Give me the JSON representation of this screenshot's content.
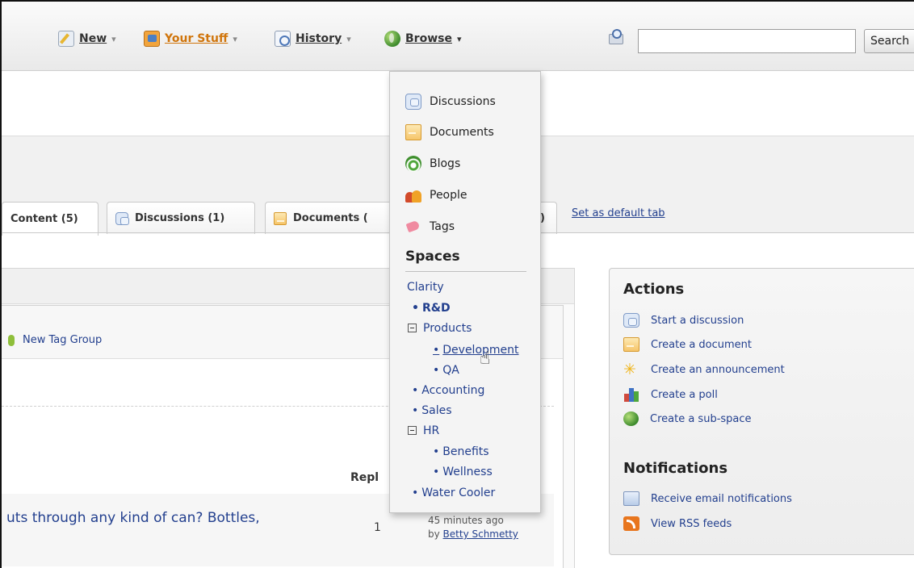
{
  "nav": {
    "items": [
      {
        "label": "New",
        "icon": "pencil-page-icon"
      },
      {
        "label": "Your Stuff",
        "icon": "user-folder-icon"
      },
      {
        "label": "History",
        "icon": "history-clock-icon"
      },
      {
        "label": "Browse",
        "icon": "globe-icon"
      }
    ],
    "search": {
      "value": "",
      "button_label": "Search"
    }
  },
  "tabs": {
    "items": [
      "Content (5)",
      "Discussions (1)",
      "Documents ("
    ],
    "partial_tail": ")",
    "set_default": "Set as default tab"
  },
  "content": {
    "new_tag_group": "New Tag Group",
    "replies_header": "Repl",
    "row": {
      "title": "uts through any kind of can? Bottles,",
      "replies": "1",
      "time": "45 minutes ago",
      "by_prefix": "by ",
      "author": "Betty Schmetty"
    }
  },
  "dropdown": {
    "items": [
      {
        "label": "Discussions",
        "icon": "discussions-icon"
      },
      {
        "label": "Documents",
        "icon": "document-icon"
      },
      {
        "label": "Blogs",
        "icon": "blog-icon"
      },
      {
        "label": "People",
        "icon": "people-icon"
      },
      {
        "label": "Tags",
        "icon": "tag-icon"
      }
    ],
    "spaces_heading": "Spaces",
    "spaces": {
      "clarity": "Clarity",
      "rd": "R&D",
      "products": "Products",
      "development": "Development",
      "qa": "QA",
      "accounting": "Accounting",
      "sales": "Sales",
      "hr": "HR",
      "benefits": "Benefits",
      "wellness": "Wellness",
      "water_cooler": "Water Cooler"
    }
  },
  "actions": {
    "heading": "Actions",
    "items": [
      {
        "label": "Start a discussion",
        "icon": "discussions-icon"
      },
      {
        "label": "Create a document",
        "icon": "document-icon"
      },
      {
        "label": "Create an announcement",
        "icon": "announcement-icon"
      },
      {
        "label": "Create a poll",
        "icon": "poll-icon"
      },
      {
        "label": "Create a sub-space",
        "icon": "globe-icon"
      }
    ]
  },
  "notifications": {
    "heading": "Notifications",
    "items": [
      {
        "label": "Receive email notifications",
        "icon": "email-icon"
      },
      {
        "label": "View RSS feeds",
        "icon": "rss-icon"
      }
    ]
  },
  "colors": {
    "link": "#223f8e",
    "your_stuff": "#d0750c"
  }
}
